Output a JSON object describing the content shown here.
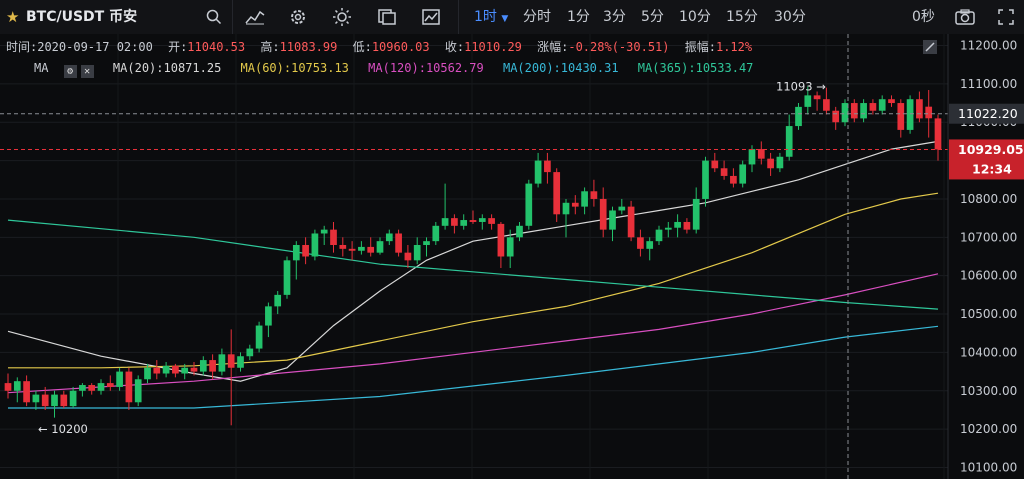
{
  "toolbar": {
    "symbol": "BTC/USDT",
    "exchange": "币安",
    "intervals": [
      "1时",
      "分时",
      "1分",
      "3分",
      "5分",
      "10分",
      "15分",
      "30分"
    ],
    "active_interval": "1时",
    "seconds_label": "0秒",
    "icons": [
      "star-icon",
      "search-icon",
      "indicators-icon",
      "settings-icon",
      "theme-icon",
      "layout-icon",
      "chart-type-icon",
      "camera-icon",
      "fullscreen-icon"
    ]
  },
  "info": {
    "time_label": "时间:",
    "time": "2020-09-17 02:00",
    "open_label": "开:",
    "open": "11040.53",
    "high_label": "高:",
    "high": "11083.99",
    "low_label": "低:",
    "low": "10960.03",
    "close_label": "收:",
    "close": "11010.29",
    "change_label": "涨幅:",
    "change": "-0.28%(-30.51)",
    "amplitude_label": "振幅:",
    "amplitude": "1.12%"
  },
  "ma_bar": {
    "label": "MA",
    "items": [
      {
        "label": "MA(20):10871.25",
        "color": "#d8d8d8"
      },
      {
        "label": "MA(60):10753.13",
        "color": "#e3c94b"
      },
      {
        "label": "MA(120):10562.79",
        "color": "#d94fc1"
      },
      {
        "label": "MA(200):10430.31",
        "color": "#38b9d8"
      },
      {
        "label": "MA(365):10533.47",
        "color": "#2fc79a"
      }
    ]
  },
  "chart_data": {
    "type": "candlestick",
    "ylim": [
      10100,
      11200
    ],
    "y_ticks": [
      "11200.00",
      "11100.00",
      "11000.00",
      "10900.00",
      "10800.00",
      "10700.00",
      "10600.00",
      "10500.00",
      "10400.00",
      "10300.00",
      "10200.00",
      "10100.00"
    ],
    "y_tick_values": [
      11200,
      11100,
      11000,
      10900,
      10800,
      10700,
      10600,
      10500,
      10400,
      10300,
      10200,
      10100
    ],
    "crosshair_price": "11022.20",
    "crosshair_value": 11022.2,
    "last_price": "10929.05",
    "last_value": 10929.05,
    "countdown": "12:34",
    "max_label": "11093 →",
    "max_value": 11093,
    "min_label": "← 10200",
    "min_value": 10200,
    "colors": {
      "up": "#23c26b",
      "down": "#e8303a",
      "ma20": "#d8d8d8",
      "ma60": "#e3c94b",
      "ma120": "#d94fc1",
      "ma200": "#38b9d8",
      "ma365": "#2fc79a"
    },
    "candles": [
      {
        "o": 10320,
        "h": 10345,
        "l": 10280,
        "c": 10300
      },
      {
        "o": 10300,
        "h": 10335,
        "l": 10270,
        "c": 10325
      },
      {
        "o": 10325,
        "h": 10340,
        "l": 10260,
        "c": 10270
      },
      {
        "o": 10270,
        "h": 10300,
        "l": 10250,
        "c": 10290
      },
      {
        "o": 10290,
        "h": 10310,
        "l": 10250,
        "c": 10260
      },
      {
        "o": 10260,
        "h": 10300,
        "l": 10230,
        "c": 10290
      },
      {
        "o": 10290,
        "h": 10300,
        "l": 10255,
        "c": 10260
      },
      {
        "o": 10260,
        "h": 10310,
        "l": 10255,
        "c": 10300
      },
      {
        "o": 10300,
        "h": 10320,
        "l": 10285,
        "c": 10315
      },
      {
        "o": 10315,
        "h": 10320,
        "l": 10290,
        "c": 10300
      },
      {
        "o": 10300,
        "h": 10330,
        "l": 10290,
        "c": 10320
      },
      {
        "o": 10320,
        "h": 10340,
        "l": 10300,
        "c": 10310
      },
      {
        "o": 10310,
        "h": 10360,
        "l": 10300,
        "c": 10350
      },
      {
        "o": 10350,
        "h": 10360,
        "l": 10250,
        "c": 10270
      },
      {
        "o": 10270,
        "h": 10340,
        "l": 10260,
        "c": 10330
      },
      {
        "o": 10330,
        "h": 10370,
        "l": 10320,
        "c": 10360
      },
      {
        "o": 10360,
        "h": 10380,
        "l": 10330,
        "c": 10345
      },
      {
        "o": 10345,
        "h": 10375,
        "l": 10335,
        "c": 10365
      },
      {
        "o": 10365,
        "h": 10370,
        "l": 10335,
        "c": 10345
      },
      {
        "o": 10345,
        "h": 10370,
        "l": 10330,
        "c": 10360
      },
      {
        "o": 10360,
        "h": 10375,
        "l": 10340,
        "c": 10350
      },
      {
        "o": 10350,
        "h": 10390,
        "l": 10340,
        "c": 10380
      },
      {
        "o": 10380,
        "h": 10395,
        "l": 10330,
        "c": 10350
      },
      {
        "o": 10350,
        "h": 10410,
        "l": 10340,
        "c": 10395
      },
      {
        "o": 10395,
        "h": 10460,
        "l": 10210,
        "c": 10360
      },
      {
        "o": 10360,
        "h": 10400,
        "l": 10350,
        "c": 10390
      },
      {
        "o": 10390,
        "h": 10420,
        "l": 10380,
        "c": 10410
      },
      {
        "o": 10410,
        "h": 10480,
        "l": 10400,
        "c": 10470
      },
      {
        "o": 10470,
        "h": 10530,
        "l": 10440,
        "c": 10520
      },
      {
        "o": 10520,
        "h": 10560,
        "l": 10500,
        "c": 10550
      },
      {
        "o": 10550,
        "h": 10650,
        "l": 10540,
        "c": 10640
      },
      {
        "o": 10640,
        "h": 10690,
        "l": 10590,
        "c": 10680
      },
      {
        "o": 10680,
        "h": 10700,
        "l": 10630,
        "c": 10650
      },
      {
        "o": 10650,
        "h": 10720,
        "l": 10640,
        "c": 10710
      },
      {
        "o": 10710,
        "h": 10730,
        "l": 10680,
        "c": 10720
      },
      {
        "o": 10720,
        "h": 10740,
        "l": 10660,
        "c": 10680
      },
      {
        "o": 10680,
        "h": 10700,
        "l": 10650,
        "c": 10670
      },
      {
        "o": 10670,
        "h": 10690,
        "l": 10640,
        "c": 10665
      },
      {
        "o": 10665,
        "h": 10690,
        "l": 10655,
        "c": 10675
      },
      {
        "o": 10675,
        "h": 10700,
        "l": 10650,
        "c": 10660
      },
      {
        "o": 10660,
        "h": 10700,
        "l": 10655,
        "c": 10690
      },
      {
        "o": 10690,
        "h": 10720,
        "l": 10680,
        "c": 10710
      },
      {
        "o": 10710,
        "h": 10720,
        "l": 10650,
        "c": 10660
      },
      {
        "o": 10660,
        "h": 10680,
        "l": 10620,
        "c": 10640
      },
      {
        "o": 10640,
        "h": 10700,
        "l": 10630,
        "c": 10680
      },
      {
        "o": 10680,
        "h": 10700,
        "l": 10650,
        "c": 10690
      },
      {
        "o": 10690,
        "h": 10740,
        "l": 10680,
        "c": 10730
      },
      {
        "o": 10730,
        "h": 10840,
        "l": 10720,
        "c": 10750
      },
      {
        "o": 10750,
        "h": 10760,
        "l": 10710,
        "c": 10730
      },
      {
        "o": 10730,
        "h": 10760,
        "l": 10720,
        "c": 10745
      },
      {
        "o": 10745,
        "h": 10770,
        "l": 10735,
        "c": 10740
      },
      {
        "o": 10740,
        "h": 10760,
        "l": 10720,
        "c": 10750
      },
      {
        "o": 10750,
        "h": 10760,
        "l": 10720,
        "c": 10735
      },
      {
        "o": 10735,
        "h": 10740,
        "l": 10620,
        "c": 10650
      },
      {
        "o": 10650,
        "h": 10720,
        "l": 10620,
        "c": 10700
      },
      {
        "o": 10700,
        "h": 10740,
        "l": 10690,
        "c": 10730
      },
      {
        "o": 10730,
        "h": 10850,
        "l": 10720,
        "c": 10840
      },
      {
        "o": 10840,
        "h": 10920,
        "l": 10830,
        "c": 10900
      },
      {
        "o": 10900,
        "h": 10920,
        "l": 10840,
        "c": 10870
      },
      {
        "o": 10870,
        "h": 10880,
        "l": 10740,
        "c": 10760
      },
      {
        "o": 10760,
        "h": 10800,
        "l": 10700,
        "c": 10790
      },
      {
        "o": 10790,
        "h": 10810,
        "l": 10760,
        "c": 10780
      },
      {
        "o": 10780,
        "h": 10830,
        "l": 10760,
        "c": 10820
      },
      {
        "o": 10820,
        "h": 10850,
        "l": 10780,
        "c": 10800
      },
      {
        "o": 10800,
        "h": 10830,
        "l": 10700,
        "c": 10720
      },
      {
        "o": 10720,
        "h": 10780,
        "l": 10690,
        "c": 10770
      },
      {
        "o": 10770,
        "h": 10800,
        "l": 10760,
        "c": 10780
      },
      {
        "o": 10780,
        "h": 10795,
        "l": 10690,
        "c": 10700
      },
      {
        "o": 10700,
        "h": 10720,
        "l": 10650,
        "c": 10670
      },
      {
        "o": 10670,
        "h": 10700,
        "l": 10640,
        "c": 10690
      },
      {
        "o": 10690,
        "h": 10730,
        "l": 10680,
        "c": 10720
      },
      {
        "o": 10720,
        "h": 10740,
        "l": 10700,
        "c": 10725
      },
      {
        "o": 10725,
        "h": 10760,
        "l": 10700,
        "c": 10740
      },
      {
        "o": 10740,
        "h": 10750,
        "l": 10710,
        "c": 10720
      },
      {
        "o": 10720,
        "h": 10830,
        "l": 10710,
        "c": 10800
      },
      {
        "o": 10800,
        "h": 10910,
        "l": 10780,
        "c": 10900
      },
      {
        "o": 10900,
        "h": 10920,
        "l": 10870,
        "c": 10880
      },
      {
        "o": 10880,
        "h": 10900,
        "l": 10850,
        "c": 10860
      },
      {
        "o": 10860,
        "h": 10880,
        "l": 10830,
        "c": 10840
      },
      {
        "o": 10840,
        "h": 10900,
        "l": 10830,
        "c": 10890
      },
      {
        "o": 10890,
        "h": 10940,
        "l": 10870,
        "c": 10930
      },
      {
        "o": 10930,
        "h": 10950,
        "l": 10890,
        "c": 10905
      },
      {
        "o": 10905,
        "h": 10920,
        "l": 10860,
        "c": 10880
      },
      {
        "o": 10880,
        "h": 10920,
        "l": 10870,
        "c": 10910
      },
      {
        "o": 10910,
        "h": 11020,
        "l": 10900,
        "c": 10990
      },
      {
        "o": 10990,
        "h": 11050,
        "l": 10980,
        "c": 11040
      },
      {
        "o": 11040,
        "h": 11093,
        "l": 11020,
        "c": 11070
      },
      {
        "o": 11070,
        "h": 11080,
        "l": 11030,
        "c": 11060
      },
      {
        "o": 11060,
        "h": 11090,
        "l": 11020,
        "c": 11030
      },
      {
        "o": 11030,
        "h": 11040,
        "l": 10980,
        "c": 11000
      },
      {
        "o": 11000,
        "h": 11060,
        "l": 10990,
        "c": 11050
      },
      {
        "o": 11050,
        "h": 11060,
        "l": 11000,
        "c": 11010
      },
      {
        "o": 11010,
        "h": 11060,
        "l": 11000,
        "c": 11050
      },
      {
        "o": 11050,
        "h": 11060,
        "l": 11020,
        "c": 11030
      },
      {
        "o": 11030,
        "h": 11070,
        "l": 11020,
        "c": 11060
      },
      {
        "o": 11060,
        "h": 11070,
        "l": 11040,
        "c": 11050
      },
      {
        "o": 11050,
        "h": 11060,
        "l": 10960,
        "c": 10980
      },
      {
        "o": 10980,
        "h": 11070,
        "l": 10970,
        "c": 11060
      },
      {
        "o": 11060,
        "h": 11080,
        "l": 11000,
        "c": 11010
      },
      {
        "o": 11040.53,
        "h": 11083.99,
        "l": 10960.03,
        "c": 11010.29
      },
      {
        "o": 11010,
        "h": 11020,
        "l": 10900,
        "c": 10929
      }
    ],
    "ma_lines": [
      {
        "key": "ma20",
        "points": [
          [
            0,
            10455
          ],
          [
            10,
            10390
          ],
          [
            20,
            10345
          ],
          [
            25,
            10325
          ],
          [
            30,
            10360
          ],
          [
            35,
            10470
          ],
          [
            40,
            10560
          ],
          [
            45,
            10640
          ],
          [
            50,
            10690
          ],
          [
            55,
            10710
          ],
          [
            60,
            10730
          ],
          [
            65,
            10750
          ],
          [
            70,
            10770
          ],
          [
            75,
            10790
          ],
          [
            80,
            10820
          ],
          [
            85,
            10850
          ],
          [
            90,
            10890
          ],
          [
            95,
            10930
          ],
          [
            100,
            10950
          ]
        ]
      },
      {
        "key": "ma60",
        "points": [
          [
            0,
            10360
          ],
          [
            10,
            10360
          ],
          [
            20,
            10365
          ],
          [
            30,
            10380
          ],
          [
            40,
            10430
          ],
          [
            50,
            10480
          ],
          [
            60,
            10520
          ],
          [
            70,
            10580
          ],
          [
            80,
            10660
          ],
          [
            90,
            10760
          ],
          [
            96,
            10800
          ],
          [
            100,
            10815
          ]
        ]
      },
      {
        "key": "ma120",
        "points": [
          [
            0,
            10295
          ],
          [
            20,
            10325
          ],
          [
            40,
            10370
          ],
          [
            60,
            10430
          ],
          [
            70,
            10460
          ],
          [
            80,
            10500
          ],
          [
            90,
            10550
          ],
          [
            100,
            10605
          ]
        ]
      },
      {
        "key": "ma200",
        "points": [
          [
            0,
            10255
          ],
          [
            20,
            10255
          ],
          [
            40,
            10285
          ],
          [
            60,
            10340
          ],
          [
            70,
            10370
          ],
          [
            80,
            10400
          ],
          [
            90,
            10440
          ],
          [
            100,
            10468
          ]
        ]
      },
      {
        "key": "ma365",
        "points": [
          [
            0,
            10745
          ],
          [
            20,
            10700
          ],
          [
            40,
            10630
          ],
          [
            60,
            10590
          ],
          [
            70,
            10570
          ],
          [
            80,
            10550
          ],
          [
            90,
            10530
          ],
          [
            100,
            10513
          ]
        ]
      }
    ]
  }
}
